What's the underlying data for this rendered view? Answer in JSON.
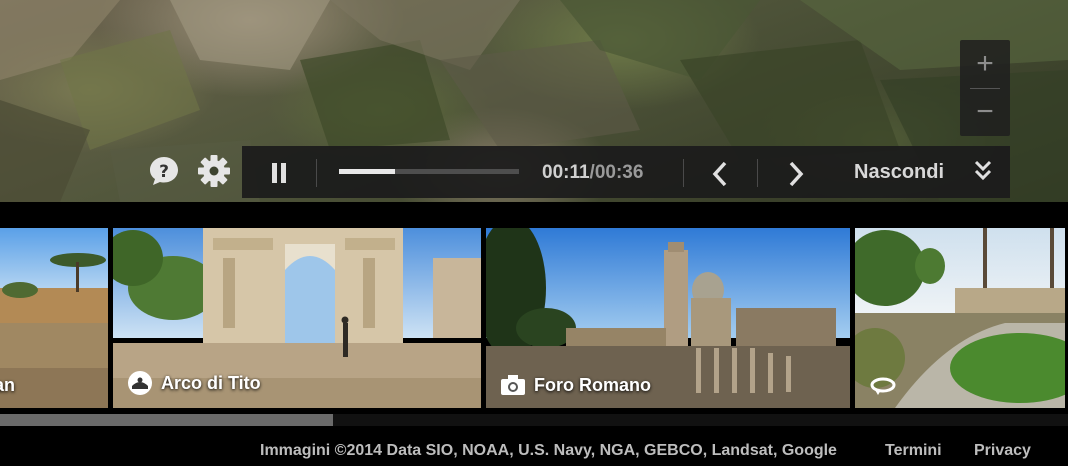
{
  "zoom": {
    "in_label": "+",
    "out_label": "−"
  },
  "icons": {
    "help": "help-bubble-icon",
    "settings": "gear-icon",
    "pause": "pause-icon",
    "prev": "chevron-left-icon",
    "next": "chevron-right-icon",
    "hide": "double-chevron-down-icon"
  },
  "tour": {
    "elapsed": "00:11",
    "total": "/00:36",
    "progress_fraction": 0.31,
    "hide_label": "Nascondi"
  },
  "thumbnails": [
    {
      "label": "an",
      "icon": "none"
    },
    {
      "label": "Arco di Tito",
      "icon": "street-view-icon"
    },
    {
      "label": "Foro Romano",
      "icon": "camera-icon"
    },
    {
      "label": "",
      "icon": "rotate-360-icon"
    }
  ],
  "scroll_fraction": 0.31,
  "footer": {
    "credits": "Immagini ©2014 Data SIO, NOAA, U.S. Navy, NGA, GEBCO, Landsat, Google",
    "terms": "Termini",
    "privacy": "Privacy"
  },
  "colors": {
    "bar_bg": "#1c1c1c",
    "progress_fill": "#e8e8e8",
    "text": "#d0d0d0"
  }
}
